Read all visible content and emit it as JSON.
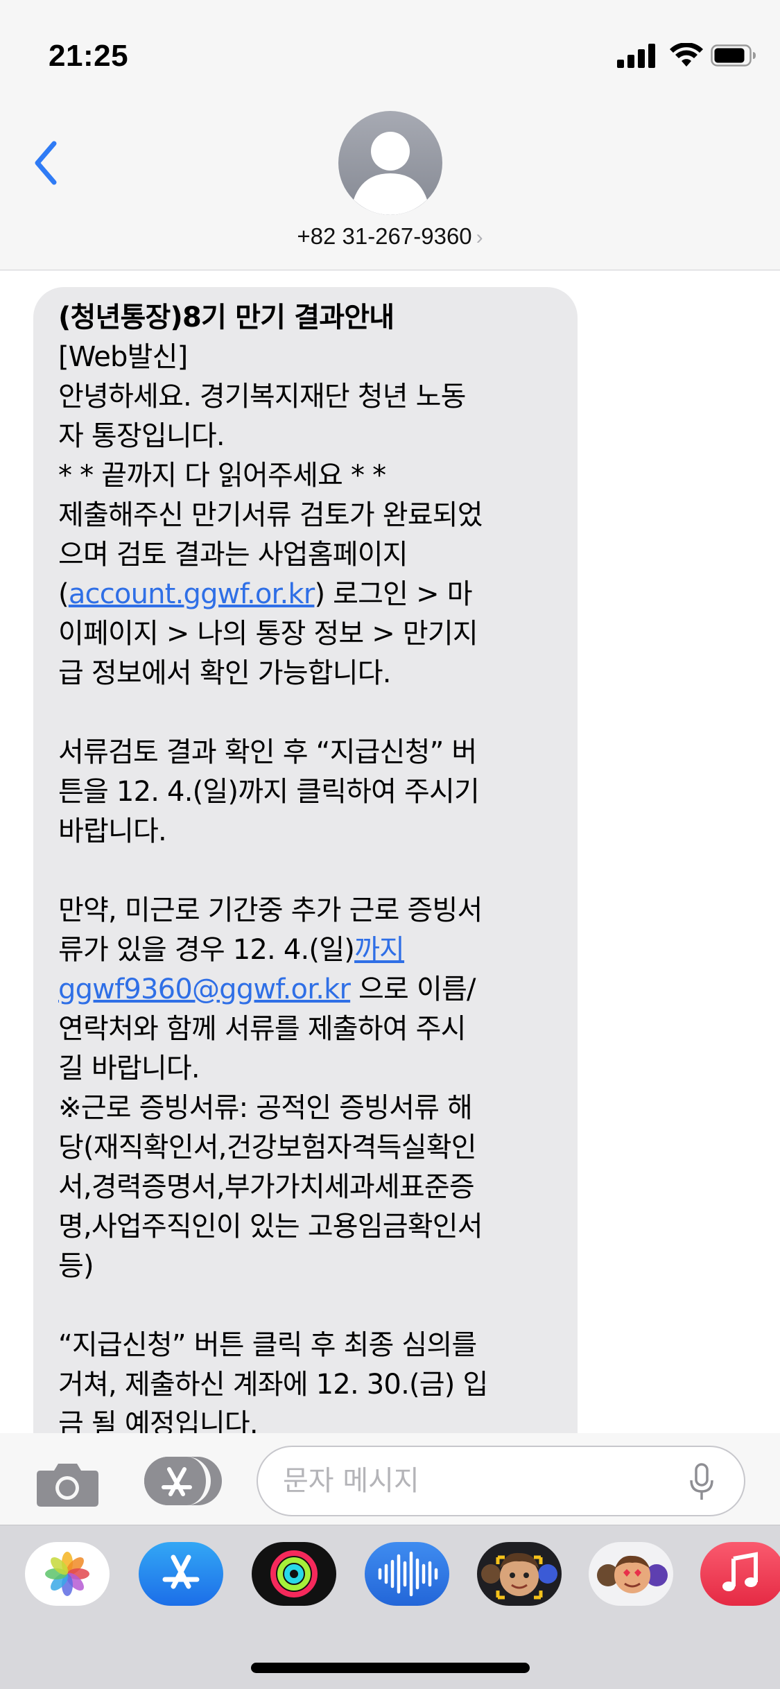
{
  "status_bar": {
    "time": "21:25",
    "icons": [
      "signal-icon",
      "wifi-icon",
      "battery-icon"
    ]
  },
  "header": {
    "back_icon": "chevron-left-icon",
    "avatar_icon": "person-silhouette-icon",
    "contact": "+82 31-267-9360",
    "contact_chevron": "›"
  },
  "message": {
    "lines": [
      {
        "text": "(청년통장)8기 만기 결과안내",
        "bold": true
      },
      {
        "text": "[Web발신]"
      },
      {
        "text": "안녕하세요. 경기복지재단 청년 노동"
      },
      {
        "text": "자 통장입니다."
      },
      {
        "text": " *  * 끝까지 다 읽어주세요 *  *"
      },
      {
        "text": "제출해주신 만기서류 검토가 완료되었"
      },
      {
        "text": "으며 검토 결과는 사업홈페이지"
      },
      {
        "pre": "(",
        "link": "account.ggwf.or.kr",
        "post": ") 로그인 > 마"
      },
      {
        "text": "이페이지 > 나의 통장 정보 > 만기지"
      },
      {
        "text": "급 정보에서 확인 가능합니다."
      },
      {
        "text": ""
      },
      {
        "text": "서류검토 결과 확인 후 “지급신청” 버"
      },
      {
        "text": "튼을 12. 4.(일)까지 클릭하여 주시기"
      },
      {
        "text": "바랍니다."
      },
      {
        "text": ""
      },
      {
        "text": "만약, 미근로 기간중 추가 근로 증빙서"
      },
      {
        "pre": "류가 있을 경우 12. 4.(일)",
        "link": "까지",
        "post": ""
      },
      {
        "pre": "",
        "link": "ggwf9360@ggwf.or.kr",
        "post": " 으로 이름/"
      },
      {
        "text": "연락처와 함께 서류를 제출하여 주시"
      },
      {
        "text": "길 바랍니다."
      },
      {
        "text": "※근로 증빙서류: 공적인 증빙서류 해"
      },
      {
        "text": "당(재직확인서,건강보험자격득실확인"
      },
      {
        "text": "서,경력증명서,부가가치세과세표준증"
      },
      {
        "text": "명,사업주직인이 있는 고용임금확인서"
      },
      {
        "text": "등)"
      },
      {
        "text": ""
      },
      {
        "text": "“지급신청” 버튼 클릭 후 최종 심의를"
      },
      {
        "text": "거쳐, 제출하신 계좌에 12. 30.(금) 입"
      },
      {
        "text": "금 될 예정입니다."
      }
    ],
    "colors": {
      "bubble": "#e9e9eb",
      "link": "#2f6fe6"
    }
  },
  "input_bar": {
    "camera_icon": "camera-icon",
    "apps_icon": "app-store-icon",
    "placeholder": "문자 메시지",
    "mic_icon": "microphone-icon"
  },
  "app_drawer": {
    "apps": [
      "photos-icon",
      "app-store-icon",
      "activity-icon",
      "audio-message-icon",
      "memoji-icon",
      "memoji-stickers-icon",
      "music-icon"
    ]
  }
}
